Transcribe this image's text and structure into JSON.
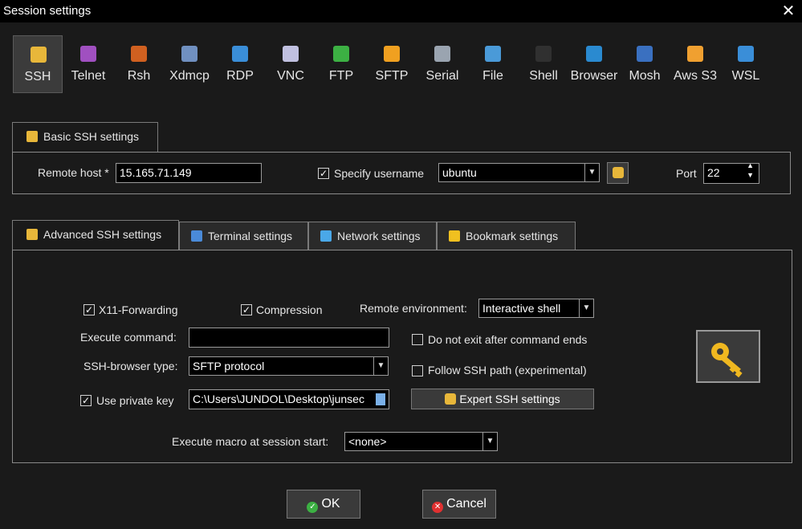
{
  "window": {
    "title": "Session settings",
    "close_glyph": "✕"
  },
  "session_types": [
    {
      "label": "SSH",
      "icon": "key-icon",
      "color": "#e8b73a"
    },
    {
      "label": "Telnet",
      "icon": "telnet-icon",
      "color": "#a050c0"
    },
    {
      "label": "Rsh",
      "icon": "rsh-icon",
      "color": "#d06020"
    },
    {
      "label": "Xdmcp",
      "icon": "xdmcp-icon",
      "color": "#7090c0"
    },
    {
      "label": "RDP",
      "icon": "rdp-icon",
      "color": "#3a8ed8"
    },
    {
      "label": "VNC",
      "icon": "vnc-icon",
      "color": "#c0c0e0"
    },
    {
      "label": "FTP",
      "icon": "ftp-globe-icon",
      "color": "#3cb043"
    },
    {
      "label": "SFTP",
      "icon": "sftp-globe-icon",
      "color": "#f0a020"
    },
    {
      "label": "Serial",
      "icon": "serial-icon",
      "color": "#9aa4b0"
    },
    {
      "label": "File",
      "icon": "file-monitor-icon",
      "color": "#4a9ad8"
    },
    {
      "label": "Shell",
      "icon": "shell-icon",
      "color": "#303030"
    },
    {
      "label": "Browser",
      "icon": "browser-globe-icon",
      "color": "#2a8ad0"
    },
    {
      "label": "Mosh",
      "icon": "mosh-icon",
      "color": "#3a70c0"
    },
    {
      "label": "Aws S3",
      "icon": "aws-icon",
      "color": "#f0a030"
    },
    {
      "label": "WSL",
      "icon": "wsl-icon",
      "color": "#3a8ed8"
    }
  ],
  "basic": {
    "tab_label": "Basic SSH settings",
    "remote_host_label": "Remote host *",
    "remote_host_value": "15.165.71.149",
    "specify_username_label": "Specify username",
    "username_value": "ubuntu",
    "port_label": "Port",
    "port_value": "22"
  },
  "tabs": [
    {
      "label": "Advanced SSH settings",
      "icon": "key-icon"
    },
    {
      "label": "Terminal settings",
      "icon": "terminal-icon"
    },
    {
      "label": "Network settings",
      "icon": "network-icon"
    },
    {
      "label": "Bookmark settings",
      "icon": "star-icon"
    }
  ],
  "advanced": {
    "x11_label": "X11-Forwarding",
    "compression_label": "Compression",
    "remote_env_label": "Remote environment:",
    "remote_env_value": "Interactive shell",
    "execute_command_label": "Execute command:",
    "execute_command_value": "",
    "do_not_exit_label": "Do not exit after command ends",
    "ssh_browser_label": "SSH-browser type:",
    "ssh_browser_value": "SFTP protocol",
    "follow_ssh_label": "Follow SSH path (experimental)",
    "use_private_key_label": "Use private key",
    "private_key_value": "C:\\Users\\JUNDOL\\Desktop\\junsec",
    "expert_button_label": "Expert SSH settings",
    "macro_label": "Execute macro at session start:",
    "macro_value": "<none>"
  },
  "footer": {
    "ok_label": "OK",
    "cancel_label": "Cancel"
  }
}
